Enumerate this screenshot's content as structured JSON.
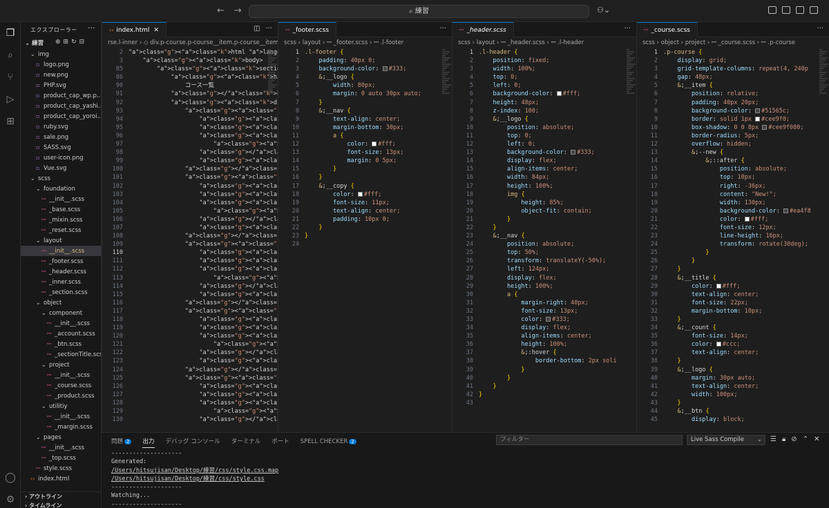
{
  "titlebar": {
    "search": "⌕ 練習",
    "back_icon": "arrow-left-icon",
    "forward_icon": "arrow-right-icon"
  },
  "sidebar": {
    "title": "エクスプローラー",
    "more": "···",
    "folder": "⌄ 練習",
    "tree": [
      {
        "label": "img",
        "depth": 1,
        "kind": "folder"
      },
      {
        "label": "logo.png",
        "depth": 2,
        "kind": "img"
      },
      {
        "label": "new.png",
        "depth": 2,
        "kind": "img"
      },
      {
        "label": "PHP.svg",
        "depth": 2,
        "kind": "img"
      },
      {
        "label": "product_cap_wp.p...",
        "depth": 2,
        "kind": "img"
      },
      {
        "label": "product_cap_yashi...",
        "depth": 2,
        "kind": "img"
      },
      {
        "label": "product_cap_yoroi...",
        "depth": 2,
        "kind": "img"
      },
      {
        "label": "ruby.svg",
        "depth": 2,
        "kind": "img"
      },
      {
        "label": "sale.png",
        "depth": 2,
        "kind": "img"
      },
      {
        "label": "SASS.svg",
        "depth": 2,
        "kind": "img"
      },
      {
        "label": "user-icon.png",
        "depth": 2,
        "kind": "img"
      },
      {
        "label": "Vue.svg",
        "depth": 2,
        "kind": "img"
      },
      {
        "label": "scss",
        "depth": 1,
        "kind": "folder"
      },
      {
        "label": "foundation",
        "depth": 2,
        "kind": "folder"
      },
      {
        "label": "__init__.scss",
        "depth": 3,
        "kind": "scss"
      },
      {
        "label": "_base.scss",
        "depth": 3,
        "kind": "scss"
      },
      {
        "label": "_mixin.scss",
        "depth": 3,
        "kind": "scss"
      },
      {
        "label": "_reset.scss",
        "depth": 3,
        "kind": "scss"
      },
      {
        "label": "layout",
        "depth": 2,
        "kind": "folder"
      },
      {
        "label": "__init__.scss",
        "depth": 3,
        "kind": "scss",
        "selected": true
      },
      {
        "label": "_footer.scss",
        "depth": 3,
        "kind": "scss"
      },
      {
        "label": "_header.scss",
        "depth": 3,
        "kind": "scss"
      },
      {
        "label": "_inner.scss",
        "depth": 3,
        "kind": "scss"
      },
      {
        "label": "_section.scss",
        "depth": 3,
        "kind": "scss"
      },
      {
        "label": "object",
        "depth": 2,
        "kind": "folder"
      },
      {
        "label": "component",
        "depth": 3,
        "kind": "folder"
      },
      {
        "label": "__init__.scss",
        "depth": 4,
        "kind": "scss"
      },
      {
        "label": "_account.scss",
        "depth": 4,
        "kind": "scss"
      },
      {
        "label": "_btn.scss",
        "depth": 4,
        "kind": "scss"
      },
      {
        "label": "_sectionTitle.scss",
        "depth": 4,
        "kind": "scss"
      },
      {
        "label": "project",
        "depth": 3,
        "kind": "folder"
      },
      {
        "label": "__init__.scss",
        "depth": 4,
        "kind": "scss"
      },
      {
        "label": "_course.scss",
        "depth": 4,
        "kind": "scss"
      },
      {
        "label": "_product.scss",
        "depth": 4,
        "kind": "scss"
      },
      {
        "label": "utilitiy",
        "depth": 3,
        "kind": "folder"
      },
      {
        "label": "__init__.scss",
        "depth": 4,
        "kind": "scss"
      },
      {
        "label": "_margin.scss",
        "depth": 4,
        "kind": "scss"
      },
      {
        "label": "pages",
        "depth": 2,
        "kind": "folder"
      },
      {
        "label": "__init__.scss",
        "depth": 3,
        "kind": "scss"
      },
      {
        "label": "_top.scss",
        "depth": 3,
        "kind": "scss"
      },
      {
        "label": "style.scss",
        "depth": 2,
        "kind": "scss"
      },
      {
        "label": "index.html",
        "depth": 1,
        "kind": "html"
      }
    ],
    "outline": "› アウトライン",
    "timeline": "› タイムライン"
  },
  "panes": [
    {
      "id": "html",
      "tab": "index.html",
      "tab_icon": "‹›",
      "crumb": "rse.l-inner › ◇ div.p-course.p-course__item.p-course__item--new",
      "start": 2,
      "current": 110,
      "lines": [
        {
          "no": "2",
          "text": "<html lang=\"ja\">"
        },
        {
          "no": "3",
          "text": "    <body>"
        },
        {
          "no": "85",
          "text": "        <section class=\"l-section l-"
        },
        {
          "no": "86",
          "text": "            <h2 class=\"c-sectionTitl"
        },
        {
          "no": "90",
          "text": "                コース一覧"
        },
        {
          "no": "91",
          "text": "            </h2>"
        },
        {
          "no": "92",
          "text": "            <div class=\"p-course l-i"
        },
        {
          "no": "93",
          "text": "                <div class=\"p-course"
        },
        {
          "no": "94",
          "text": "                    <h3 class=\"p-cou"
        },
        {
          "no": "95",
          "text": "                    <div class=\"p-co"
        },
        {
          "no": "96",
          "text": "                    <div class=\"p-co"
        },
        {
          "no": "97",
          "text": "                        <img src=\"im"
        },
        {
          "no": "98",
          "text": "                    </div>"
        },
        {
          "no": "99",
          "text": "                    <a href=\"\" class"
        },
        {
          "no": "100",
          "text": "                </div>"
        },
        {
          "no": "101",
          "text": "                <div class=\"p-course"
        },
        {
          "no": "102",
          "text": "                    <h3 class=\"p-cou"
        },
        {
          "no": "103",
          "text": "                    <div class=\"p-co"
        },
        {
          "no": "104",
          "text": "                    <div class=\"p-co"
        },
        {
          "no": "105",
          "text": "                        <img src=\"im"
        },
        {
          "no": "106",
          "text": "                    </div>"
        },
        {
          "no": "107",
          "text": "                    <a href=\"\" class"
        },
        {
          "no": "108",
          "text": "                </div>"
        },
        {
          "no": "109",
          "text": "                <div class=\"p-course"
        },
        {
          "no": "110",
          "text": "                    <h3 class=\"p-cou"
        },
        {
          "no": "111",
          "text": "                    <div class=\"p-co"
        },
        {
          "no": "112",
          "text": "                    <div class=\"p-co"
        },
        {
          "no": "113",
          "text": "                        <img src=\"im"
        },
        {
          "no": "114",
          "text": "                    </div>"
        },
        {
          "no": "115",
          "text": "                    <a href=\"\" class"
        },
        {
          "no": "116",
          "text": "                </div>"
        },
        {
          "no": "117",
          "text": "                <div class=\"p-course"
        },
        {
          "no": "118",
          "text": "                    <h3 class=\"p-cou"
        },
        {
          "no": "119",
          "text": "                    <div class=\"p-co"
        },
        {
          "no": "120",
          "text": "                    <div class=\"p-co"
        },
        {
          "no": "121",
          "text": "                        <img src=\"im"
        },
        {
          "no": "122",
          "text": "                    </div>"
        },
        {
          "no": "123",
          "text": "                    <a href=\"\" class"
        },
        {
          "no": "124",
          "text": "                </div>"
        },
        {
          "no": "125",
          "text": "                <div class=\"p-course"
        },
        {
          "no": "126",
          "text": "                    <h3 class=\"p-cou"
        },
        {
          "no": "127",
          "text": "                    <div class=\"p-co"
        },
        {
          "no": "128",
          "text": "                    <div class=\"p-co"
        },
        {
          "no": "129",
          "text": "                        <img src=\"im"
        },
        {
          "no": "130",
          "text": "                    </div>"
        }
      ]
    },
    {
      "id": "footer",
      "tab": "_footer.scss",
      "tab_icon": "ꟷ",
      "crumb": "scss › layout › ꟷ _footer.scss › ꟷ .l-footer",
      "current": 1,
      "lines": [
        {
          "no": "1",
          "text": ".l-footer {"
        },
        {
          "no": "2",
          "text": "    padding: 40px 0;"
        },
        {
          "no": "3",
          "text": "    background-color: ■#333;"
        },
        {
          "no": "4",
          "text": "    &__logo {"
        },
        {
          "no": "5",
          "text": "        width: 80px;"
        },
        {
          "no": "6",
          "text": "        margin: 0 auto 30px auto;"
        },
        {
          "no": "7",
          "text": "    }"
        },
        {
          "no": "8",
          "text": "    &__nav {"
        },
        {
          "no": "9",
          "text": "        text-align: center;"
        },
        {
          "no": "10",
          "text": "        margin-bottom: 30px;"
        },
        {
          "no": "11",
          "text": "        a {"
        },
        {
          "no": "12",
          "text": "            color: □#fff;"
        },
        {
          "no": "13",
          "text": "            font-size: 13px;"
        },
        {
          "no": "14",
          "text": "            margin: 0 5px;"
        },
        {
          "no": "15",
          "text": "        }"
        },
        {
          "no": "16",
          "text": "    }"
        },
        {
          "no": "17",
          "text": "    &__copy {"
        },
        {
          "no": "18",
          "text": "        color: □#fff;"
        },
        {
          "no": "19",
          "text": "        font-size: 11px;"
        },
        {
          "no": "20",
          "text": "        text-align: center;"
        },
        {
          "no": "21",
          "text": "        padding: 10px 0;"
        },
        {
          "no": "22",
          "text": "    }"
        },
        {
          "no": "23",
          "text": "}"
        },
        {
          "no": "24",
          "text": ""
        }
      ]
    },
    {
      "id": "header",
      "tab": "_header.scss",
      "tab_icon": "ꟷ",
      "crumb": "scss › layout › ꟷ _header.scss › ꟷ .l-header",
      "current": 1,
      "lines": [
        {
          "no": "1",
          "text": ".l-header {"
        },
        {
          "no": "2",
          "text": "    position: fixed;"
        },
        {
          "no": "3",
          "text": "    width: 100%;"
        },
        {
          "no": "4",
          "text": "    top: 0;"
        },
        {
          "no": "5",
          "text": "    left: 0;"
        },
        {
          "no": "6",
          "text": "    background-color: □#fff;"
        },
        {
          "no": "7",
          "text": "    height: 48px;"
        },
        {
          "no": "8",
          "text": "    z-index: 100;"
        },
        {
          "no": "9",
          "text": "    &__logo {"
        },
        {
          "no": "10",
          "text": "        position: absolute;"
        },
        {
          "no": "11",
          "text": "        top: 0;"
        },
        {
          "no": "12",
          "text": "        left: 0;"
        },
        {
          "no": "13",
          "text": "        background-color: ■#333;"
        },
        {
          "no": "14",
          "text": "        display: flex;"
        },
        {
          "no": "15",
          "text": "        align-items: center;"
        },
        {
          "no": "16",
          "text": "        width: 84px;"
        },
        {
          "no": "17",
          "text": "        height: 100%;"
        },
        {
          "no": "18",
          "text": "        img {"
        },
        {
          "no": "19",
          "text": "            height: 85%;"
        },
        {
          "no": "20",
          "text": "            object-fit: contain;"
        },
        {
          "no": "21",
          "text": "        }"
        },
        {
          "no": "22",
          "text": "    }"
        },
        {
          "no": "23",
          "text": "    &__nav {"
        },
        {
          "no": "24",
          "text": "        position: absolute;"
        },
        {
          "no": "25",
          "text": "        top: 50%;"
        },
        {
          "no": "26",
          "text": "        transform: translateY(-50%);"
        },
        {
          "no": "27",
          "text": "        left: 124px;"
        },
        {
          "no": "28",
          "text": "        display: flex;"
        },
        {
          "no": "29",
          "text": "        height: 100%;"
        },
        {
          "no": "30",
          "text": "        a {"
        },
        {
          "no": "31",
          "text": "            margin-right: 40px;"
        },
        {
          "no": "32",
          "text": "            font-size: 13px;"
        },
        {
          "no": "33",
          "text": "            color: ■#333;"
        },
        {
          "no": "34",
          "text": "            display: flex;"
        },
        {
          "no": "35",
          "text": "            align-items: center;"
        },
        {
          "no": "36",
          "text": "            height: 100%;"
        },
        {
          "no": "37",
          "text": "            &:hover {"
        },
        {
          "no": "38",
          "text": "                border-bottom: 2px soli"
        },
        {
          "no": "39",
          "text": "            }"
        },
        {
          "no": "40",
          "text": "        }"
        },
        {
          "no": "41",
          "text": "    }"
        },
        {
          "no": "42",
          "text": "}"
        },
        {
          "no": "43",
          "text": ""
        }
      ]
    },
    {
      "id": "course",
      "tab": "_course.scss",
      "tab_icon": "ꟷ",
      "crumb": "scss › object › project › ꟷ _course.scss › ꟷ .p-course",
      "current": 1,
      "lines": [
        {
          "no": "1",
          "text": ".p-course {"
        },
        {
          "no": "2",
          "text": "    display: grid;"
        },
        {
          "no": "3",
          "text": "    grid-template-columns: repeat(4, 240p"
        },
        {
          "no": "4",
          "text": "    gap: 48px;"
        },
        {
          "no": "5",
          "text": "    &__item {"
        },
        {
          "no": "6",
          "text": "        position: relative;"
        },
        {
          "no": "7",
          "text": "        padding: 40px 20px;"
        },
        {
          "no": "8",
          "text": "        background-color: ■#51565c;"
        },
        {
          "no": "9",
          "text": "        border: solid 1px □#cee9f0;"
        },
        {
          "no": "10",
          "text": "        box-shadow: 0 0 8px ■#cee9f080;"
        },
        {
          "no": "11",
          "text": "        border-radius: 5px;"
        },
        {
          "no": "12",
          "text": "        overflow: hidden;"
        },
        {
          "no": "13",
          "text": "        &--new {"
        },
        {
          "no": "14",
          "text": "            &::after {"
        },
        {
          "no": "15",
          "text": "                position: absolute;"
        },
        {
          "no": "16",
          "text": "                top: 10px;"
        },
        {
          "no": "17",
          "text": "                right: -36px;"
        },
        {
          "no": "18",
          "text": "                content: \"New!\";"
        },
        {
          "no": "19",
          "text": "                width: 130px;"
        },
        {
          "no": "20",
          "text": "                background-color: ■#ea4f8"
        },
        {
          "no": "21",
          "text": "                color: □#fff;"
        },
        {
          "no": "22",
          "text": "                font-size: 12px;"
        },
        {
          "no": "23",
          "text": "                line-height: 16px;"
        },
        {
          "no": "24",
          "text": "                transform: rotate(30deg);"
        },
        {
          "no": "25",
          "text": "            }"
        },
        {
          "no": "26",
          "text": "        }"
        },
        {
          "no": "27",
          "text": "    }"
        },
        {
          "no": "28",
          "text": "    &__title {"
        },
        {
          "no": "29",
          "text": "        color: □#fff;"
        },
        {
          "no": "30",
          "text": "        text-align: center;"
        },
        {
          "no": "31",
          "text": "        font-size: 22px;"
        },
        {
          "no": "32",
          "text": "        margin-bottom: 10px;"
        },
        {
          "no": "33",
          "text": "    }"
        },
        {
          "no": "34",
          "text": "    &__count {"
        },
        {
          "no": "35",
          "text": "        font-size: 14px;"
        },
        {
          "no": "36",
          "text": "        color: □#ccc;"
        },
        {
          "no": "37",
          "text": "        text-align: center;"
        },
        {
          "no": "38",
          "text": "    }"
        },
        {
          "no": "39",
          "text": "    &__logo {"
        },
        {
          "no": "40",
          "text": "        margin: 30px auto;"
        },
        {
          "no": "41",
          "text": "        text-align: center;"
        },
        {
          "no": "42",
          "text": "        width: 100px;"
        },
        {
          "no": "43",
          "text": "    }"
        },
        {
          "no": "44",
          "text": "    &__btn {"
        },
        {
          "no": "45",
          "text": "        display: block;"
        }
      ]
    }
  ],
  "panel": {
    "tabs": [
      {
        "label": "問題",
        "badge": "2"
      },
      {
        "label": "出力",
        "active": true
      },
      {
        "label": "デバッグ コンソール"
      },
      {
        "label": "ターミナル"
      },
      {
        "label": "ポート"
      },
      {
        "label": "SPELL CHECKER",
        "badge": "2"
      }
    ],
    "filter_placeholder": "フィルター",
    "compile_select": "Live Sass Compile",
    "output": [
      {
        "text": "--------------------",
        "link": false
      },
      {
        "text": "Generated:",
        "link": false
      },
      {
        "text": "/Users/hitsujisan/Desktop/練習/css/style.css.map",
        "link": true
      },
      {
        "text": "/Users/hitsujisan/Desktop/練習/css/style.css",
        "link": true
      },
      {
        "text": "--------------------",
        "link": false
      },
      {
        "text": "Watching...",
        "link": false
      },
      {
        "text": "--------------------",
        "link": false
      }
    ]
  },
  "colors": {
    "accent": "#0078d4",
    "editor_bg": "#1e1e1e",
    "sidebar_bg": "#181818"
  }
}
